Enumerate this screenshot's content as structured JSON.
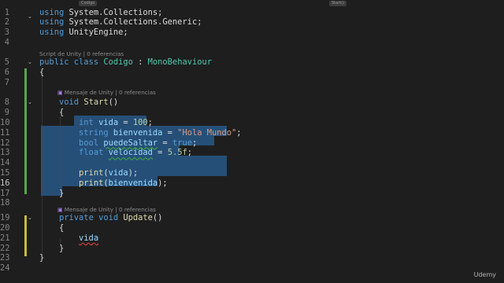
{
  "tabs": {
    "left": "Codigo",
    "right": "Start()"
  },
  "hints": {
    "class_hint": "Script de Unity | 0 referencias",
    "start_hint": "Mensaje de Unity | 0 referencias",
    "update_hint": "Mensaje de Unity | 0 referencias"
  },
  "lines": [
    {
      "n": "1",
      "t": [
        [
          "kw",
          "using "
        ],
        [
          "tx",
          "System.Collections;"
        ]
      ]
    },
    {
      "n": "2",
      "t": [
        [
          "kw",
          "using "
        ],
        [
          "tx",
          "System.Collections.Generic;"
        ]
      ]
    },
    {
      "n": "3",
      "t": [
        [
          "kw",
          "using "
        ],
        [
          "tx",
          "UnityEngine;"
        ]
      ]
    },
    {
      "n": "4",
      "t": []
    },
    {
      "n": "5",
      "t": [
        [
          "kw",
          "public class "
        ],
        [
          "ty",
          "Codigo"
        ],
        [
          "tx",
          " : "
        ],
        [
          "ty",
          "MonoBehaviour"
        ]
      ]
    },
    {
      "n": "6",
      "t": [
        [
          "tx",
          "{"
        ]
      ]
    },
    {
      "n": "7",
      "t": []
    },
    {
      "n": "8",
      "t": [
        [
          "tx",
          "    "
        ],
        [
          "kw",
          "void "
        ],
        [
          "mt",
          "Start"
        ],
        [
          "tx",
          "()"
        ]
      ]
    },
    {
      "n": "9",
      "t": [
        [
          "tx",
          "    {"
        ]
      ]
    },
    {
      "n": "10",
      "t": [
        [
          "tx",
          "        "
        ],
        [
          "kw",
          "int "
        ],
        [
          "vr",
          "vida"
        ],
        [
          "tx",
          " = "
        ],
        [
          "nm",
          "100"
        ],
        [
          "tx",
          ";"
        ]
      ]
    },
    {
      "n": "11",
      "t": [
        [
          "tx",
          "        "
        ],
        [
          "kw",
          "string "
        ],
        [
          "vr",
          "bienvenida"
        ],
        [
          "tx",
          " = "
        ],
        [
          "st",
          "\"Hola Mundo\""
        ],
        [
          "tx",
          ";"
        ]
      ]
    },
    {
      "n": "12",
      "t": [
        [
          "tx",
          "        "
        ],
        [
          "kw",
          "bool "
        ],
        [
          "vr sq",
          "puedeSaltar"
        ],
        [
          "tx",
          " = "
        ],
        [
          "kw",
          "true"
        ],
        [
          "tx",
          ";"
        ]
      ]
    },
    {
      "n": "13",
      "t": [
        [
          "tx",
          "        "
        ],
        [
          "kw",
          "float "
        ],
        [
          "vr sq",
          "velocidad"
        ],
        [
          "tx",
          " = "
        ],
        [
          "nm",
          "5.5f"
        ],
        [
          "tx",
          ";"
        ]
      ]
    },
    {
      "n": "14",
      "t": []
    },
    {
      "n": "15",
      "t": [
        [
          "tx",
          "        "
        ],
        [
          "mt",
          "print"
        ],
        [
          "tx",
          "("
        ],
        [
          "vr",
          "vida"
        ],
        [
          "tx",
          ");"
        ]
      ]
    },
    {
      "n": "16",
      "t": [
        [
          "tx",
          "        "
        ],
        [
          "mt",
          "print"
        ],
        [
          "tx",
          "("
        ],
        [
          "vr",
          "bienvenida"
        ],
        [
          "tx",
          ");"
        ]
      ]
    },
    {
      "n": "17",
      "t": [
        [
          "tx",
          "    }"
        ]
      ]
    },
    {
      "n": "18",
      "t": []
    },
    {
      "n": "19",
      "t": [
        [
          "tx",
          "    "
        ],
        [
          "kw",
          "private void "
        ],
        [
          "mt",
          "Update"
        ],
        [
          "tx",
          "()"
        ]
      ]
    },
    {
      "n": "20",
      "t": [
        [
          "tx",
          "    {"
        ]
      ]
    },
    {
      "n": "21",
      "t": [
        [
          "tx",
          "        "
        ],
        [
          "vr sqr",
          "vida"
        ]
      ]
    },
    {
      "n": "22",
      "t": [
        [
          "tx",
          "    }"
        ]
      ]
    },
    {
      "n": "23",
      "t": [
        [
          "tx",
          "}"
        ]
      ]
    },
    {
      "n": "24",
      "t": []
    }
  ],
  "active_line": "16",
  "watermark": "Udemy"
}
